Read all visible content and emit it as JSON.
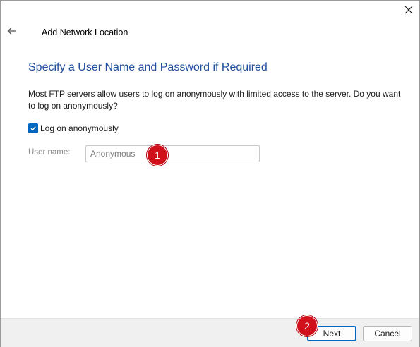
{
  "window": {
    "title": "Add Network Location",
    "close_icon": "close-icon",
    "back_icon": "back-arrow-icon"
  },
  "page": {
    "heading": "Specify a User Name and Password if Required",
    "description": "Most FTP servers allow users to log on anonymously with limited access to the server.  Do you want to log on anonymously?",
    "anonymous_checkbox": {
      "label": "Log on anonymously",
      "checked": true
    },
    "username": {
      "label": "User name:",
      "value": "Anonymous",
      "disabled": true
    }
  },
  "annotations": {
    "badge1": "1",
    "badge2": "2",
    "color": "#d0101a"
  },
  "footer": {
    "next_label": "Next",
    "cancel_label": "Cancel"
  },
  "colors": {
    "accent": "#0067c0",
    "heading": "#1f4e9c"
  }
}
